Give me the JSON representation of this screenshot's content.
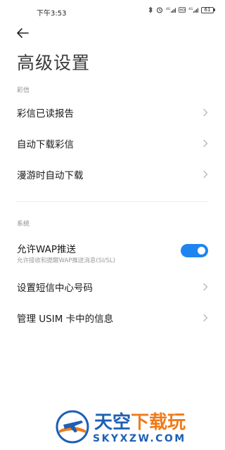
{
  "status_bar": {
    "time": "下午3:53",
    "battery": "61"
  },
  "header": {
    "back_icon": "arrow-left-icon",
    "title": "高级设置"
  },
  "sections": [
    {
      "header": "彩信",
      "items": [
        {
          "label": "彩信已读报告"
        },
        {
          "label": "自动下载彩信"
        },
        {
          "label": "漫游时自动下载"
        }
      ]
    },
    {
      "header": "系统",
      "toggle": {
        "label": "允许WAP推送",
        "description": "允许接收和提醒WAP推送消息(SI/SL)",
        "enabled": true
      },
      "items": [
        {
          "label": "设置短信中心号码"
        },
        {
          "label": "管理 USIM 卡中的信息"
        }
      ]
    }
  ],
  "watermark": {
    "cn_part1": "天空",
    "cn_part2": "下载玩",
    "en": "SKYXZW.COM"
  },
  "colors": {
    "accent": "#1f84f0",
    "watermark_blue": "#1d5fb4",
    "watermark_orange": "#f07a1a"
  }
}
